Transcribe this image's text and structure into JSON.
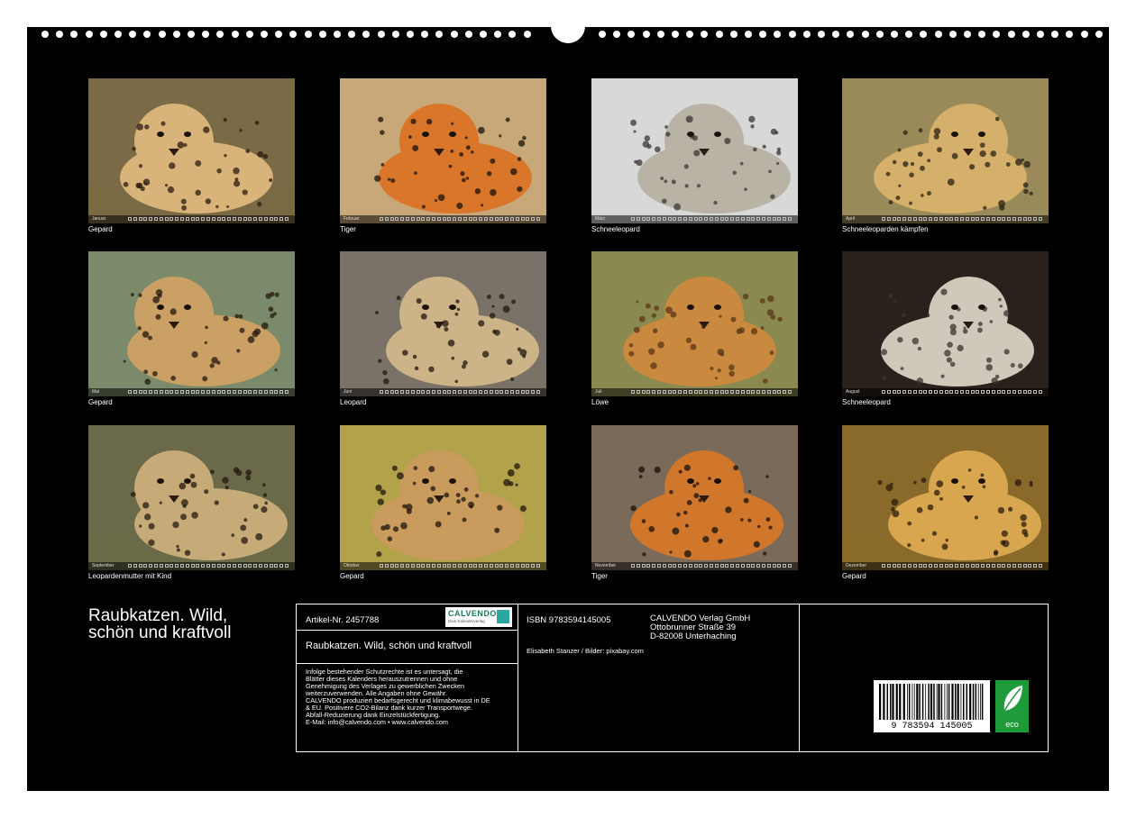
{
  "photos": [
    {
      "caption": "Gepard",
      "month": "Januar",
      "bg": "#7a6a45",
      "fg": "#d9b47a",
      "spot": "#2a1c10"
    },
    {
      "caption": "Tiger",
      "month": "Februar",
      "bg": "#c8a878",
      "fg": "#d9762a",
      "spot": "#1b120b"
    },
    {
      "caption": "Schneeleopard",
      "month": "März",
      "bg": "#d8d8d8",
      "fg": "#b9b3a6",
      "spot": "#3a3633"
    },
    {
      "caption": "Schneeleoparden kämpfen",
      "month": "April",
      "bg": "#9a8a5a",
      "fg": "#d4b06a",
      "spot": "#2b2113"
    },
    {
      "caption": "Gepard",
      "month": "Mai",
      "bg": "#7a8a6a",
      "fg": "#caa064",
      "spot": "#24180e"
    },
    {
      "caption": "Leopard",
      "month": "Juni",
      "bg": "#7a7268",
      "fg": "#cdb488",
      "spot": "#20170f"
    },
    {
      "caption": "Löwe",
      "month": "Juli",
      "bg": "#8a8a50",
      "fg": "#c9893f",
      "spot": "#5a3515"
    },
    {
      "caption": "Schneeleopard",
      "month": "August",
      "bg": "#2a211c",
      "fg": "#cfc8bb",
      "spot": "#3a3430"
    },
    {
      "caption": "Leopardenmutter mit Kind",
      "month": "September",
      "bg": "#6a6a4a",
      "fg": "#c6aa78",
      "spot": "#231a10"
    },
    {
      "caption": "Gepard",
      "month": "Oktober",
      "bg": "#b2a24a",
      "fg": "#c99b5c",
      "spot": "#1f150d"
    },
    {
      "caption": "Tiger",
      "month": "November",
      "bg": "#7a6a5a",
      "fg": "#d0772c",
      "spot": "#17100a"
    },
    {
      "caption": "Gepard",
      "month": "Dezember",
      "bg": "#8a6a2a",
      "fg": "#d9a650",
      "spot": "#2b1c0d"
    }
  ],
  "title": {
    "line1": "Raubkatzen. Wild,",
    "line2": "schön und kraftvoll"
  },
  "info": {
    "article_no": "Artikel-Nr. 2457788",
    "product_title": "Raubkatzen. Wild, schön und kraftvoll",
    "isbn": "ISBN 9783594145005",
    "publisher": [
      "CALVENDO Verlag GmbH",
      "Ottobrunner Straße 39",
      "D-82008 Unterhaching"
    ],
    "credits": "Elisabeth Stanzer / Bilder: pixabay.com",
    "legal": [
      "Infolge bestehender Schutzrechte ist es untersagt, die",
      "Blätter dieses Kalenders herauszutrennen und ohne",
      "Genehmigung des Verlages zu gewerblichen Zwecken",
      "weiterzuverwenden. Alle Angaben ohne Gewähr.",
      "CALVENDO produziert bedarfsgerecht und klimabewusst in DE",
      "& EU. Positivere CO2-Bilanz dank kurzer Transportwege.",
      "Abfall-Reduzierung dank Einzelstückfertigung.",
      "E-Mail: info@calvendo.com • www.calvendo.com"
    ],
    "logo_name": "CALVENDO",
    "logo_sub": "Dein Kalenderverlag",
    "barcode_digits": "9 783594 145005",
    "eco_label": "eco"
  }
}
